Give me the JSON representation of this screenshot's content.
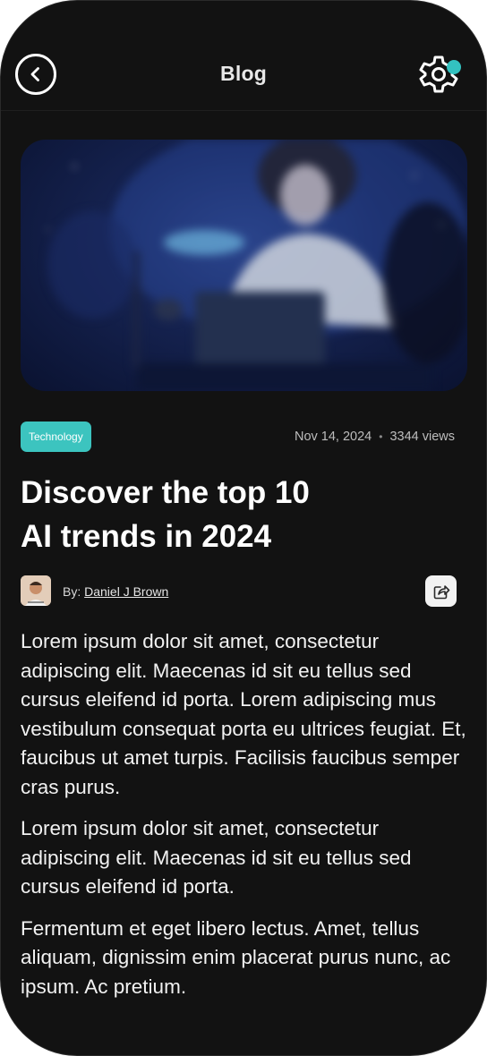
{
  "header": {
    "title": "Blog",
    "back_icon": "chevron-left-icon",
    "settings_icon": "gear-icon",
    "notification_color": "#33c2c0"
  },
  "article": {
    "category": "Technology",
    "date": "Nov 14, 2024",
    "separator": "•",
    "views": "3344 views",
    "title_line1": "Discover the top 10",
    "title_line2": "AI trends in 2024",
    "author_prefix": "By:",
    "author_name": "Daniel J Brown",
    "share_icon": "share-icon",
    "paragraphs": [
      "Lorem ipsum dolor sit amet, consectetur adipiscing elit. Maecenas id sit eu tellus sed cursus eleifend id porta. Lorem adipiscing mus vestibulum consequat porta eu ultrices feugiat. Et, faucibus ut amet turpis. Facilisis faucibus semper cras purus.",
      "Lorem ipsum dolor sit amet, consectetur adipiscing elit. Maecenas id sit eu tellus sed cursus eleifend id porta.",
      "Fermentum et eget libero lectus. Amet, tellus aliquam, dignissim enim placerat purus nunc, ac ipsum. Ac pretium."
    ]
  },
  "colors": {
    "background": "#121212",
    "accent": "#3cc4bf",
    "text": "#ffffff"
  }
}
